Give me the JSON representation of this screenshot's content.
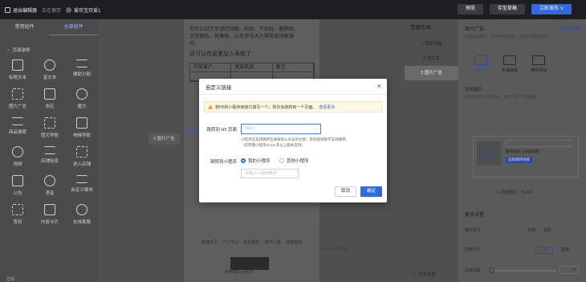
{
  "topbar": {
    "exit_label": "退出编辑器",
    "saving_text": "正在保存",
    "page_title": "爱欢宝欢爱1",
    "buttons": [
      "预览",
      "存至草稿",
      "立即发布 ∨"
    ]
  },
  "left_panel": {
    "tabs": [
      "常用组件",
      "全部组件"
    ],
    "section_label": "页面装修",
    "items": [
      {
        "label": "标题文本",
        "icon": "title-text-icon"
      },
      {
        "label": "富文本",
        "icon": "rich-text-icon"
      },
      {
        "label": "辅助分割",
        "icon": "divider-icon"
      },
      {
        "label": "图片广告",
        "icon": "image-ad-icon"
      },
      {
        "label": "热区",
        "icon": "hotspot-icon"
      },
      {
        "label": "魔方",
        "icon": "cube-icon"
      },
      {
        "label": "商品搜索",
        "icon": "product-search-icon"
      },
      {
        "label": "图文导航",
        "icon": "image-nav-icon"
      },
      {
        "label": "电梯导航",
        "icon": "elevator-nav-icon"
      },
      {
        "label": "视频",
        "icon": "video-icon"
      },
      {
        "label": "店铺信息",
        "icon": "store-info-icon"
      },
      {
        "label": "进入店铺",
        "icon": "enter-store-icon"
      },
      {
        "label": "公告",
        "icon": "notice-icon"
      },
      {
        "label": "语音",
        "icon": "voice-icon"
      },
      {
        "label": "自定义模块",
        "icon": "custom-module-icon"
      },
      {
        "label": "签到",
        "icon": "checkin-icon"
      },
      {
        "label": "内容卡片",
        "icon": "content-card-icon"
      },
      {
        "label": "在线客服",
        "icon": "customer-service-icon"
      }
    ],
    "next_section": "营销"
  },
  "canvas": {
    "rich_text_line1": "你可以对文字进行加粗、斜体、下划线、删除线、",
    "rich_text_line2": "文字颜色、背景色、以及字号大小等简单排版操",
    "rich_text_line3": "作。",
    "question": "还可以在这里加入表格了",
    "table_header": [
      "中奖客户",
      "发放奖品",
      "备注"
    ],
    "side_label": "3 图片广告",
    "clipped_left_text": "也可",
    "clipped_left_text2": "便地",
    "footer_links": "店铺主页 个人中心 关注我们 线下门店 店铺信息",
    "thumb_caption": "免费领取10元红包",
    "preview_note": "iPhone 5 分界线"
  },
  "layout_panel": {
    "title": "页面布局",
    "items": [
      "1 顶部导航",
      "2 富文本",
      "3 图片广告"
    ],
    "active_index": 2,
    "footer": "页面设置"
  },
  "right_panel": {
    "title": "图片广告",
    "example_link": "查看示例",
    "description": "轮播海报模块：支持单图和多图，支持分享到朋友圈",
    "selected_style_header": "选择模板",
    "styles": [
      "一行一个",
      "轮播海报",
      "横向滑动"
    ],
    "add_image_title": "添加图片",
    "add_image_desc": "建议图片尺寸宽度750，高度不限，尺寸规格",
    "add_image_link": "尺寸规格",
    "card_add_label": "添加图片",
    "card_title_placeholder": "请输入标题（非必填）",
    "card_opt1": "整体跳转",
    "card_opt2": "分热区跳转",
    "card_pick": "选择跳转链接",
    "add_button": "+ 添加图片（1/10）",
    "more_settings": "更多设置",
    "image_style_label": "图片样式",
    "image_style_opts": [
      "常规",
      "投影"
    ],
    "corner_label": "边角样式",
    "corner_opts": [
      "方角",
      "圆角"
    ],
    "margin_label": "页面边距",
    "margin_value": "0"
  },
  "modal": {
    "title": "自定义链接",
    "alert_text": "若H5和小程序链接只填写一个，则仅会跳转到一个页面。",
    "alert_link": "查看更多",
    "h5_label": "跳转到 H5 页面",
    "h5_placeholder": "http://",
    "h5_help": "小程序已支持跳转至关联的公众号的文章，其他链接暂不支持跳转。（有赞微小程序v2.18 及以上版本支持）",
    "mp_label": "跳转到小程序",
    "radio_options": [
      "我的小程序",
      "其他小程序"
    ],
    "selected_radio": 0,
    "mp_placeholder": "请输入小程序路径",
    "cancel_label": "取消",
    "confirm_label": "确定"
  },
  "colors": {
    "primary": "#2f6ae0",
    "topbar": "#1d1e22",
    "warning": "#f2a526"
  }
}
